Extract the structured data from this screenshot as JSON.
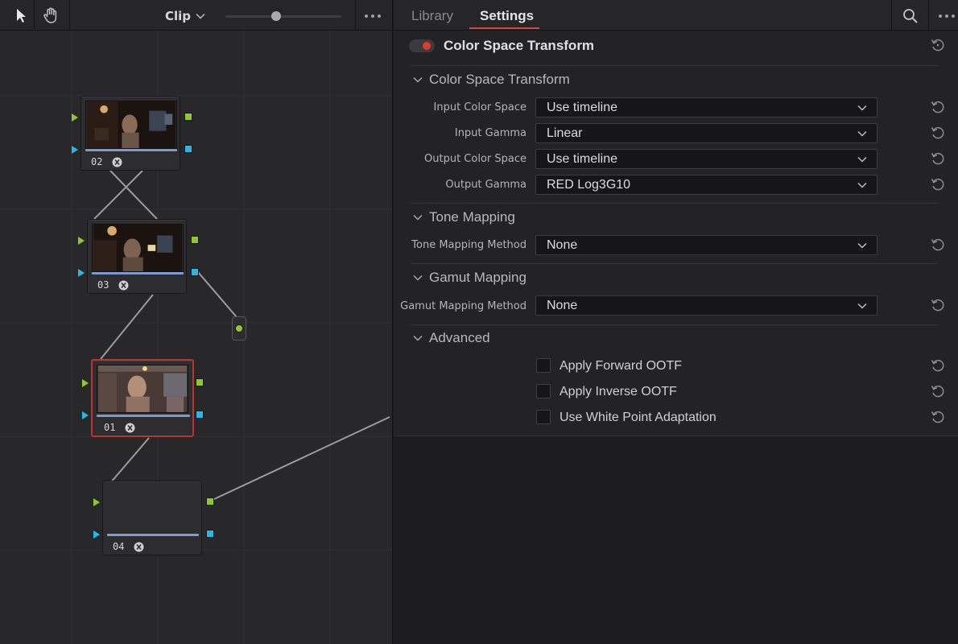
{
  "node_editor": {
    "mode_label": "Clip",
    "nodes": [
      {
        "id": "02",
        "label": "02"
      },
      {
        "id": "03",
        "label": "03"
      },
      {
        "id": "01",
        "label": "01",
        "selected": true
      },
      {
        "id": "04",
        "label": "04"
      }
    ]
  },
  "tabs": {
    "library": "Library",
    "settings": "Settings"
  },
  "effect": {
    "title": "Color Space Transform",
    "enabled": true,
    "toggle_color": "#e03a2c"
  },
  "sections": {
    "cst": {
      "title": "Color Space Transform",
      "rows": [
        {
          "label": "Input Color Space",
          "value": "Use timeline"
        },
        {
          "label": "Input Gamma",
          "value": "Linear"
        },
        {
          "label": "Output Color Space",
          "value": "Use timeline"
        },
        {
          "label": "Output Gamma",
          "value": "RED Log3G10"
        }
      ]
    },
    "tone": {
      "title": "Tone Mapping",
      "label": "Tone Mapping Method",
      "value": "None"
    },
    "gamut": {
      "title": "Gamut Mapping",
      "label": "Gamut Mapping Method",
      "value": "None"
    },
    "advanced": {
      "title": "Advanced",
      "options": [
        {
          "label": "Apply Forward OOTF",
          "checked": false
        },
        {
          "label": "Apply Inverse OOTF",
          "checked": false
        },
        {
          "label": "Use White Point Adaptation",
          "checked": false
        }
      ]
    }
  },
  "colors": {
    "accent_red": "#d44a3c",
    "port_green": "#8fc92d",
    "port_blue": "#29b7ea",
    "node_bar": "#7d9bd1"
  },
  "icons": {
    "pointer": "pointer-icon",
    "hand": "hand-icon",
    "chevron": "chevron-down-icon",
    "more": "more-horizontal-icon",
    "search": "search-icon",
    "reset": "reset-icon",
    "fx": "fx-effect-icon"
  }
}
